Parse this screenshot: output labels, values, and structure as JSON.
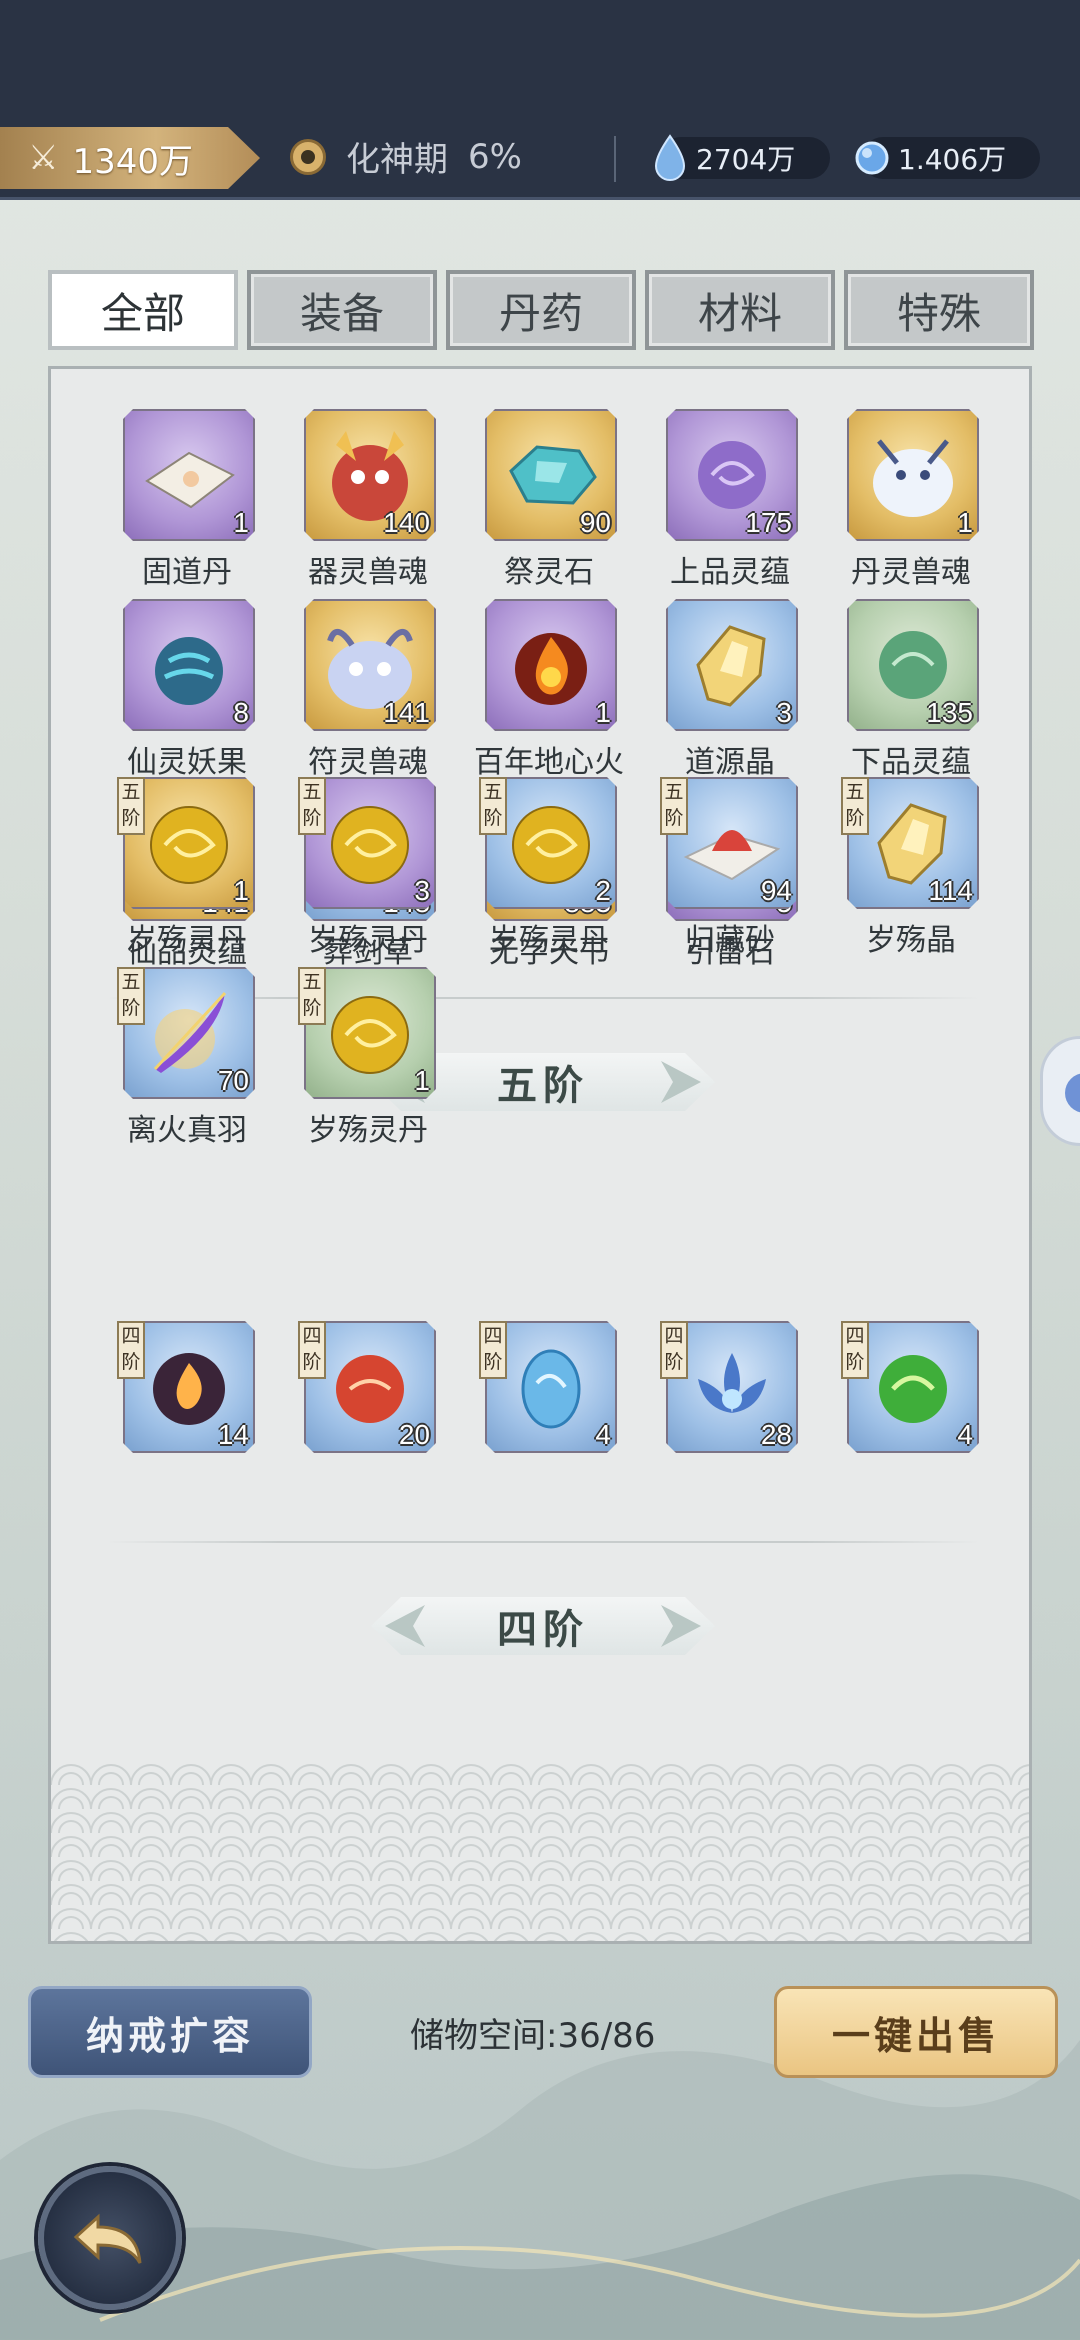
{
  "topbar": {
    "power": "1340万",
    "realm_name": "化神期",
    "realm_progress": "6%",
    "currency1": "2704万",
    "currency2": "1.406万"
  },
  "tabs": [
    "全部",
    "装备",
    "丹药",
    "材料",
    "特殊"
  ],
  "active_tab": "全部",
  "items_general": [
    {
      "name": "固道丹",
      "count": "1",
      "quality": "purple",
      "icon": "paper-icon"
    },
    {
      "name": "器灵兽魂",
      "count": "140",
      "quality": "gold",
      "icon": "beast-soul-icon"
    },
    {
      "name": "祭灵石",
      "count": "90",
      "quality": "gold",
      "icon": "blue-stone-icon"
    },
    {
      "name": "上品灵蕴",
      "count": "175",
      "quality": "purple",
      "icon": "purple-orb-icon"
    },
    {
      "name": "丹灵兽魂",
      "count": "1",
      "quality": "gold",
      "icon": "dragon-soul-icon"
    },
    {
      "name": "仙灵妖果",
      "count": "8",
      "quality": "purple",
      "icon": "demon-fruit-icon"
    },
    {
      "name": "符灵兽魂",
      "count": "141",
      "quality": "gold",
      "icon": "cute-beast-icon"
    },
    {
      "name": "百年地心火",
      "count": "1",
      "quality": "purple",
      "icon": "fire-icon"
    },
    {
      "name": "道源晶",
      "count": "3",
      "quality": "blue",
      "icon": "yellow-crystal-icon"
    },
    {
      "name": "下品灵蕴",
      "count": "135",
      "quality": "green",
      "icon": "green-orb-icon"
    },
    {
      "name": "仙品灵蕴",
      "count": "141",
      "quality": "gold",
      "icon": "gold-orb-icon"
    },
    {
      "name": "葬剑草",
      "count": "148",
      "quality": "blue",
      "icon": "herb-icon"
    },
    {
      "name": "无字天书",
      "count": "883",
      "quality": "gold",
      "icon": "scroll-icon"
    },
    {
      "name": "引雷石",
      "count": "5",
      "quality": "purple",
      "icon": "thunder-crystal-icon"
    }
  ],
  "section5": {
    "title": "五阶",
    "tier_label": "五阶",
    "items": [
      {
        "name": "岁殇灵丹",
        "count": "1",
        "quality": "gold",
        "icon": "gold-orb-icon"
      },
      {
        "name": "岁殇灵丹",
        "count": "3",
        "quality": "purple",
        "icon": "gold-orb-icon"
      },
      {
        "name": "岁殇灵丹",
        "count": "2",
        "quality": "blue",
        "icon": "gold-orb-icon"
      },
      {
        "name": "归藏砂",
        "count": "94",
        "quality": "blue",
        "icon": "red-sand-icon"
      },
      {
        "name": "岁殇晶",
        "count": "114",
        "quality": "blue",
        "icon": "yellow-crystal-icon"
      },
      {
        "name": "离火真羽",
        "count": "70",
        "quality": "blue",
        "icon": "feather-icon"
      },
      {
        "name": "岁殇灵丹",
        "count": "1",
        "quality": "green",
        "icon": "gold-orb-icon"
      }
    ]
  },
  "section4": {
    "title": "四阶",
    "tier_label": "四阶",
    "items": [
      {
        "count": "14",
        "quality": "blue",
        "icon": "fire-orb-icon"
      },
      {
        "count": "20",
        "quality": "blue",
        "icon": "red-orb-icon"
      },
      {
        "count": "4",
        "quality": "blue",
        "icon": "water-egg-icon"
      },
      {
        "count": "28",
        "quality": "blue",
        "icon": "lotus-icon"
      },
      {
        "count": "4",
        "quality": "blue",
        "icon": "jade-orb-icon"
      }
    ]
  },
  "bottom": {
    "expand_label": "纳戒扩容",
    "storage_label": "储物空间:36/86",
    "sell_label": "一键出售"
  }
}
